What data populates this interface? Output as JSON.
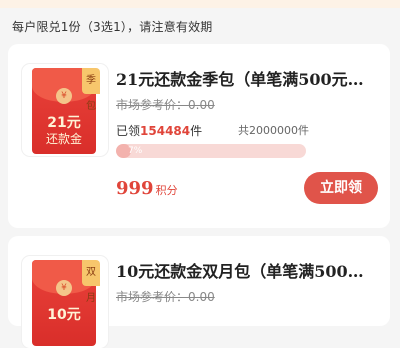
{
  "notice": "每户限兑1份（3选1），请注意有效期",
  "items": [
    {
      "tag": "季包",
      "thumb_amount": "21元",
      "thumb_sub": "还款金",
      "coin_symbol": "¥",
      "title": "21元还款金季包（单笔满500元可...",
      "market_label": "市场参考价：",
      "market_price": "0.00",
      "claimed_prefix": "已领",
      "claimed_count": "154484",
      "claimed_suffix": "件",
      "total": "共2000000件",
      "progress_text": "7%",
      "progress_value": 0.07,
      "price": "999",
      "price_unit": "积分",
      "button": "立即领"
    },
    {
      "tag": "双月",
      "thumb_amount": "10元",
      "coin_symbol": "¥",
      "title": "10元还款金双月包（单笔满500元...",
      "market_label": "市场参考价：",
      "market_price": "0.00"
    }
  ],
  "colors": {
    "accent": "#e0453a",
    "button": "#e0544a",
    "envelope": "#d92e2a",
    "tag": "#f7c66c"
  }
}
